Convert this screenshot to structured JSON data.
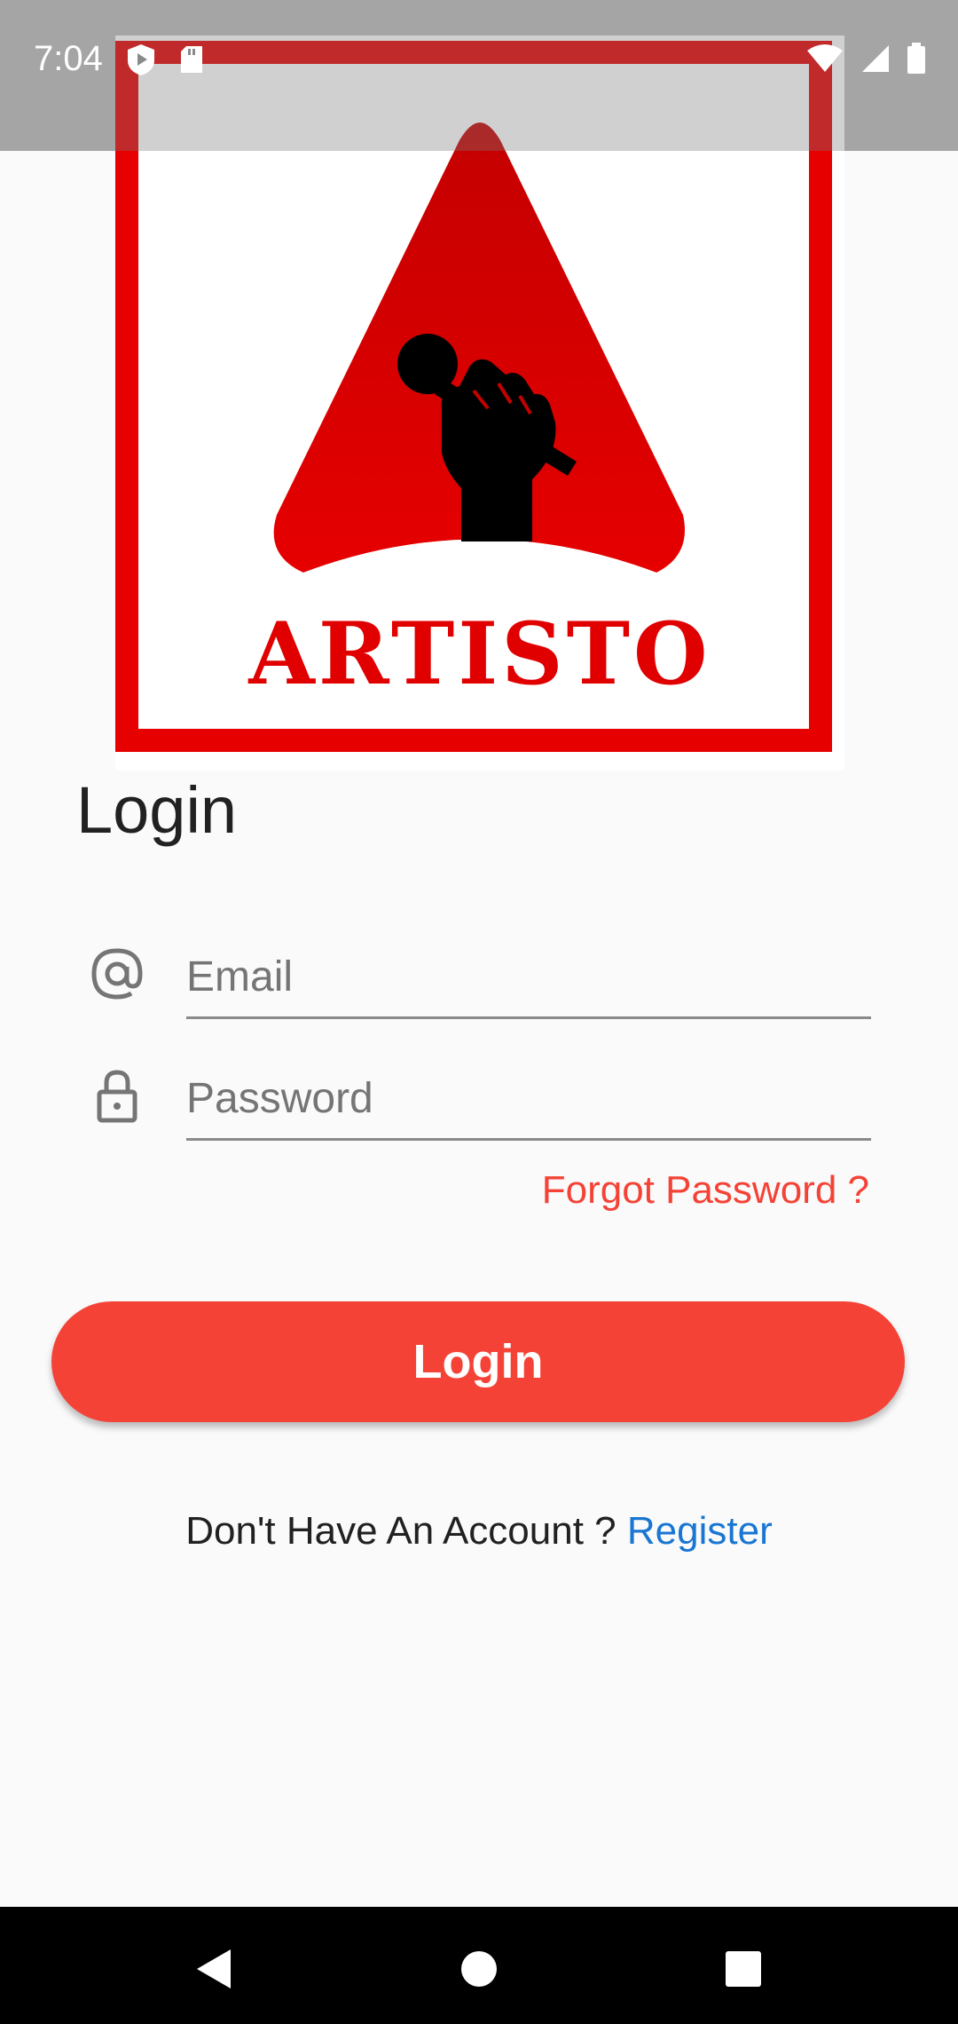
{
  "status_bar": {
    "time": "7:04"
  },
  "logo": {
    "brand_text": "ARTISTO"
  },
  "page": {
    "title": "Login"
  },
  "form": {
    "email": {
      "placeholder": "Email",
      "value": ""
    },
    "password": {
      "placeholder": "Password",
      "value": ""
    },
    "forgot_label": "Forgot Password ?",
    "login_label": "Login"
  },
  "footer": {
    "prompt": "Don't Have An Account ?",
    "register_label": "Register"
  },
  "icons": {
    "email": "at-sign-icon",
    "password": "lock-icon",
    "back": "back-triangle-icon",
    "home": "home-circle-icon",
    "recents": "recents-square-icon"
  },
  "colors": {
    "accent": "#f44336",
    "link": "#1976d2",
    "logo_red": "#e00000"
  }
}
